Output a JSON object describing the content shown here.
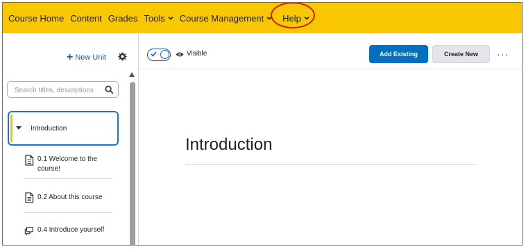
{
  "navbar": {
    "items": [
      {
        "label": "Course Home",
        "has_menu": false
      },
      {
        "label": "Content",
        "has_menu": false
      },
      {
        "label": "Grades",
        "has_menu": false
      },
      {
        "label": "Tools",
        "has_menu": true
      },
      {
        "label": "Course Management",
        "has_menu": true
      }
    ],
    "help_label": "Help",
    "background": "#f9c800",
    "highlight_color": "#d11a1a"
  },
  "sidebar": {
    "new_unit_label": "New Unit",
    "settings_icon": "gear-icon",
    "search_placeholder": "Search titles, descriptions",
    "selected_unit": "Introduction",
    "topics": [
      {
        "label": "0.1 Welcome to the course!",
        "icon": "document-icon"
      },
      {
        "label": "0.2 About this course",
        "icon": "document-icon"
      },
      {
        "label": "0.4 Introduce yourself",
        "icon": "discussion-icon"
      }
    ]
  },
  "toolbar": {
    "visibility_label": "Visible",
    "visibility_on": true,
    "add_existing_label": "Add Existing",
    "create_new_label": "Create New",
    "more_label": "···",
    "primary_color": "#006fbf"
  },
  "main": {
    "title": "Introduction"
  }
}
